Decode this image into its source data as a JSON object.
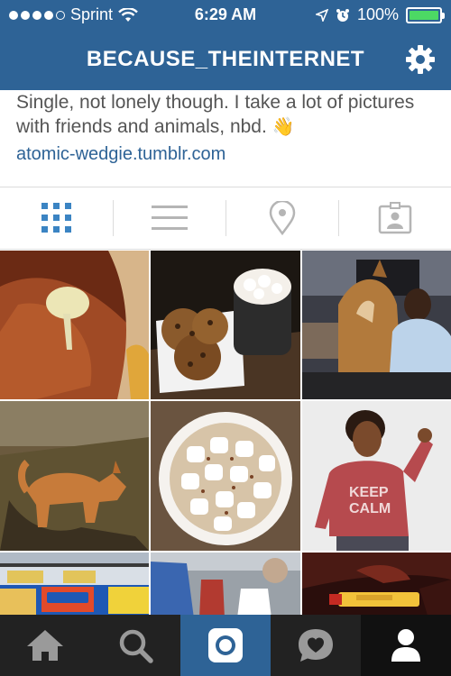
{
  "status_bar": {
    "carrier": "Sprint",
    "time": "6:29 AM",
    "battery": "100%",
    "battery_level": 1.0
  },
  "header": {
    "username": "BECAUSE_THEINTERNET",
    "settings_icon": "gear-icon"
  },
  "bio": {
    "text": "Single, not lonely though. I take a lot of pictures with friends and animals, nbd.",
    "emoji": "👋",
    "link": "atomic-wedgie.tumblr.com"
  },
  "view_tabs": [
    {
      "name": "grid-view",
      "icon": "grid-icon",
      "active": true
    },
    {
      "name": "list-view",
      "icon": "list-icon",
      "active": false
    },
    {
      "name": "map-view",
      "icon": "location-pin-icon",
      "active": false
    },
    {
      "name": "tagged-view",
      "icon": "tagged-person-icon",
      "active": false
    }
  ],
  "photos": [
    {
      "subject": "hand-holding-mushroom"
    },
    {
      "subject": "cookies-and-hot-cocoa"
    },
    {
      "subject": "boy-with-dog"
    },
    {
      "subject": "dog-on-grass"
    },
    {
      "subject": "cocoa-with-marshmallows"
    },
    {
      "subject": "girl-in-red-sweater"
    },
    {
      "subject": "snack-shelf"
    },
    {
      "subject": "drink-bag"
    },
    {
      "subject": "lip-balm"
    }
  ],
  "bottom_nav": [
    {
      "name": "home",
      "icon": "home-icon"
    },
    {
      "name": "explore",
      "icon": "search-icon"
    },
    {
      "name": "camera",
      "icon": "camera-icon",
      "active": true
    },
    {
      "name": "activity",
      "icon": "heart-bubble-icon"
    },
    {
      "name": "profile",
      "icon": "person-icon"
    }
  ],
  "colors": {
    "header": "#2e6396",
    "link": "#2e6396",
    "active_tab": "#3b84c3",
    "inactive_tab": "#b5b5b5",
    "bottom_bar": "#222222",
    "battery_fill": "#4cd964"
  }
}
